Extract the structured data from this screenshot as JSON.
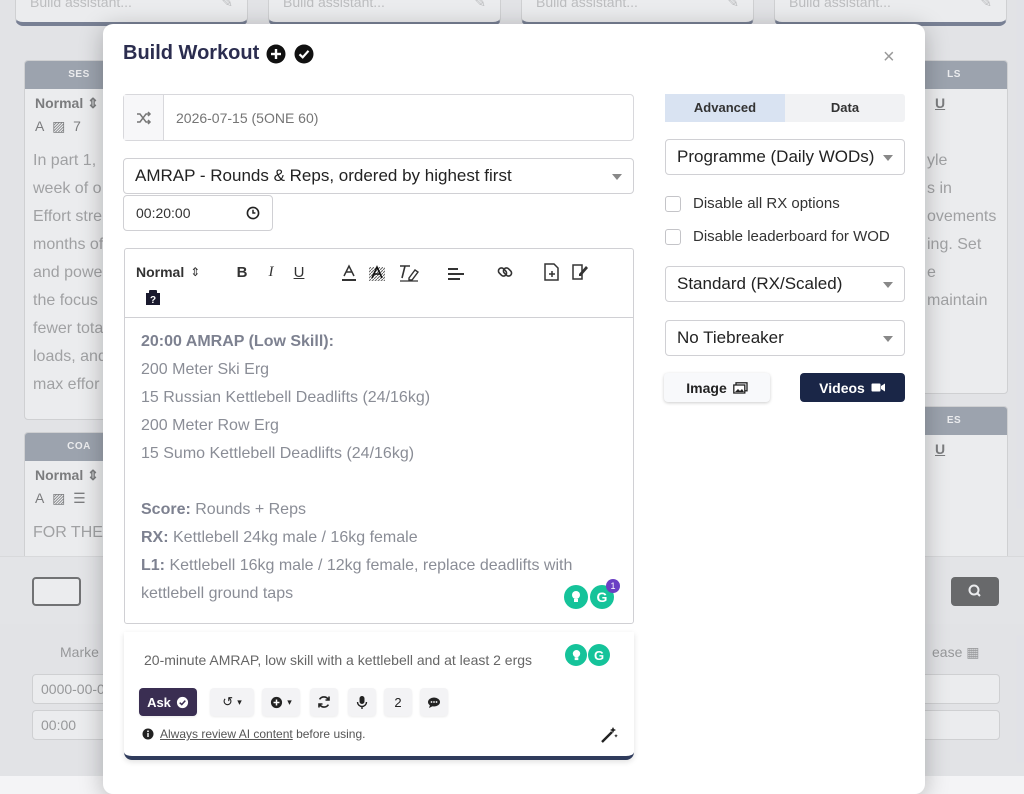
{
  "background": {
    "assistant_placeholder": "Build assistant...",
    "card_headers": [
      "SES",
      "LS",
      "COA",
      "ES"
    ],
    "toolbar_format": "Normal",
    "card_text": [
      "In part 1,",
      "week of o",
      "Effort stre",
      "months of",
      "and powe",
      "the focus",
      "fewer tota",
      "loads, and",
      "max effor"
    ],
    "right_card_text": [
      "yle",
      "s in",
      "ovements",
      "ing. Set",
      "e",
      "",
      "maintain"
    ],
    "coa_text": "FOR THE",
    "market_label": "Marke",
    "release_label": "ease",
    "market_date": "0000-00-0",
    "market_time": "00:00"
  },
  "modal": {
    "title": "Build Workout",
    "close_label": "×",
    "date_placeholder": "2026-07-15 (5ONE 60)",
    "scoring_select": "AMRAP - Rounds & Reps, ordered by highest first",
    "time_cap": "00:20:00",
    "editor": {
      "format_label": "Normal",
      "lines": [
        {
          "bold": "20:00 AMRAP (Low Skill):",
          "text": ""
        },
        {
          "bold": "",
          "text": "200 Meter Ski Erg"
        },
        {
          "bold": "",
          "text": "15 Russian Kettlebell Deadlifts (24/16kg)"
        },
        {
          "bold": "",
          "text": "200 Meter Row Erg"
        },
        {
          "bold": "",
          "text": "15 Sumo Kettlebell Deadlifts (24/16kg)"
        },
        {
          "bold": "",
          "text": ""
        },
        {
          "bold": "Score:",
          "text": " Rounds + Reps"
        },
        {
          "bold": "RX:",
          "text": " Kettlebell 24kg male / 16kg female"
        },
        {
          "bold": "L1:",
          "text": " Kettlebell 16kg male / 12kg female, replace deadlifts with"
        },
        {
          "bold": "",
          "text": "kettlebell ground taps"
        }
      ],
      "grammarly_count": "1"
    },
    "ai": {
      "prompt": "20-minute AMRAP, low skill with a kettlebell and at least 2 ergs",
      "ask_label": "Ask",
      "count": "2",
      "note_link": "Always review AI content",
      "note_rest": "before using."
    },
    "tabs": [
      {
        "label": "Advanced",
        "active": true
      },
      {
        "label": "Data",
        "active": false
      }
    ],
    "programme_select": "Programme (Daily WODs)",
    "checkboxes": [
      {
        "label": "Disable all RX options"
      },
      {
        "label": "Disable leaderboard for WOD"
      }
    ],
    "standard_select": "Standard (RX/Scaled)",
    "tiebreak_select": "No Tiebreaker",
    "image_button": "Image",
    "videos_button": "Videos"
  }
}
